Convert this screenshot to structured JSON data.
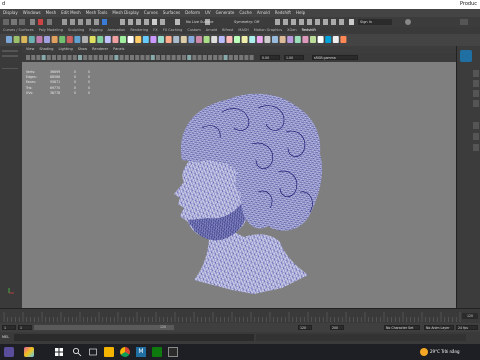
{
  "window": {
    "title": "d",
    "right_label": "Produc"
  },
  "menu": [
    "Display",
    "Windows",
    "Mesh",
    "Edit Mesh",
    "Mesh Tools",
    "Mesh Display",
    "Curves",
    "Surfaces",
    "Deform",
    "UV",
    "Generate",
    "Cache",
    "Arnold",
    "Redshift",
    "Help"
  ],
  "status": {
    "no_live_surface": "No Live Surface",
    "symmetry": "Symmetry: Off",
    "sign_in": "Sign In"
  },
  "shelf_tabs": [
    "Curves / Surfaces",
    "Poly Modeling",
    "Sculpting",
    "Rigging",
    "Animation",
    "Rendering",
    "FX",
    "FX Caching",
    "Custom",
    "Arnold",
    "Bifrost",
    "MASH",
    "Motion Graphics",
    "XGen",
    "Redshift"
  ],
  "shelf_active": "Redshift",
  "panel_menu": [
    "View",
    "Shading",
    "Lighting",
    "Show",
    "Renderer",
    "Panels"
  ],
  "panel_toolbar": {
    "near_value": "0.00",
    "far_value": "1.00",
    "color_space": "sRGB gamma"
  },
  "hud": {
    "rows": [
      {
        "label": "Verts:",
        "v1": "36699",
        "v2": "0",
        "v3": "0"
      },
      {
        "label": "Edges:",
        "v1": "88586",
        "v2": "0",
        "v3": "0"
      },
      {
        "label": "Faces:",
        "v1": "55871",
        "v2": "0",
        "v3": "0"
      },
      {
        "label": "Tris:",
        "v1": "69770",
        "v2": "0",
        "v3": "0"
      },
      {
        "label": "UVs:",
        "v1": "38778",
        "v2": "0",
        "v3": "0"
      }
    ]
  },
  "timeline": {
    "start": "1",
    "end": "120",
    "current": "120",
    "range_end": "200"
  },
  "range": {
    "start_a": "1",
    "start_b": "1",
    "end_a": "120",
    "end_b": "200",
    "char_set": "No Character Set",
    "anim_layer": "No Anim Layer",
    "fps": "24 fps"
  },
  "mel": {
    "label": "MEL"
  },
  "taskbar": {
    "weather": "29°C Trời nắng"
  },
  "colors": {
    "accent": "#00a3d9",
    "wire": "#15158c",
    "viewport_bg": "#7f7f7f"
  }
}
